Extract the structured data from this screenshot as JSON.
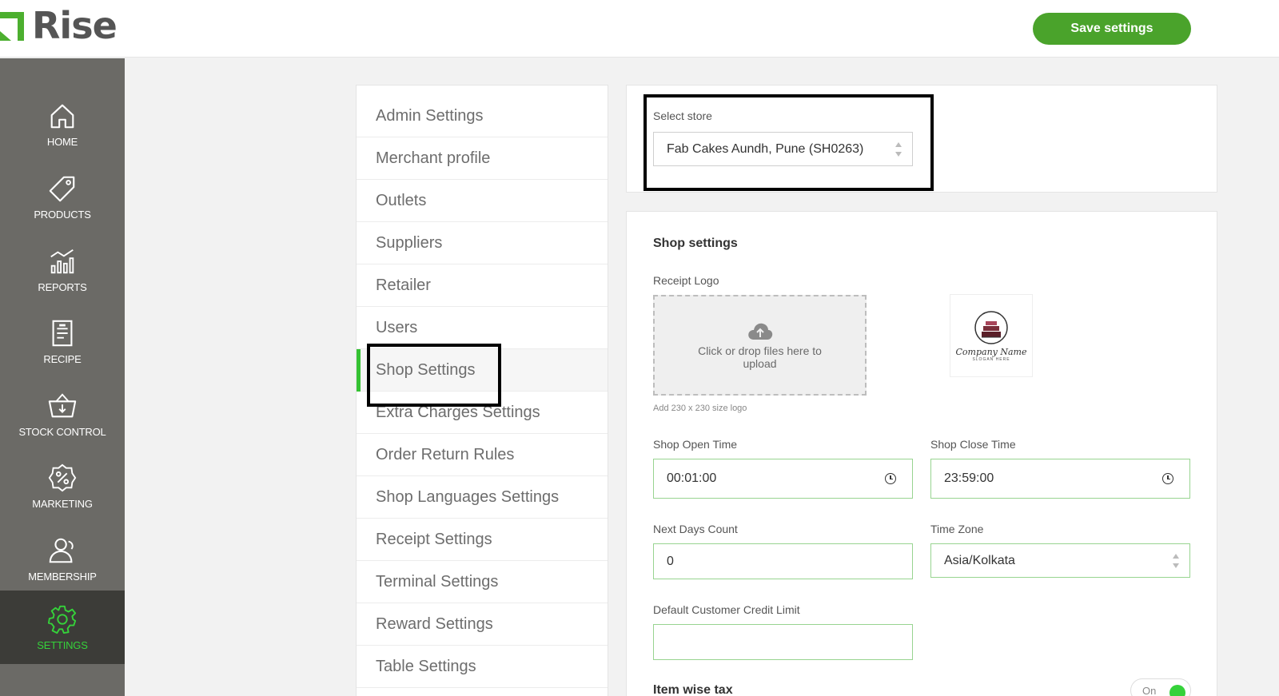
{
  "header": {
    "logo_text": "Rise",
    "save_label": "Save settings"
  },
  "sidebar": {
    "items": [
      {
        "label": "HOME",
        "icon": "home-icon"
      },
      {
        "label": "PRODUCTS",
        "icon": "tag-icon"
      },
      {
        "label": "REPORTS",
        "icon": "reports-icon"
      },
      {
        "label": "RECIPE",
        "icon": "recipe-icon"
      },
      {
        "label": "STOCK CONTROL",
        "icon": "basket-icon"
      },
      {
        "label": "MARKETING",
        "icon": "percent-badge-icon"
      },
      {
        "label": "MEMBERSHIP",
        "icon": "members-icon"
      },
      {
        "label": "SETTINGS",
        "icon": "gear-icon",
        "active": true
      }
    ]
  },
  "settings_menu": {
    "items": [
      "Admin Settings",
      "Merchant profile",
      "Outlets",
      "Suppliers",
      "Retailer",
      "Users",
      "Shop Settings",
      "Extra Charges Settings",
      "Order Return Rules",
      "Shop Languages Settings",
      "Receipt Settings",
      "Terminal Settings",
      "Reward Settings",
      "Table Settings"
    ],
    "active": "Shop Settings"
  },
  "store": {
    "label": "Select store",
    "value": "Fab Cakes Aundh, Pune (SH0263)"
  },
  "shop": {
    "title": "Shop settings",
    "receipt_logo_label": "Receipt Logo",
    "upload_text": "Click or drop files here to upload",
    "logo_hint": "Add 230 x 230 size logo",
    "logo_preview": {
      "company_name": "Company Name",
      "slogan": "SLOGAN HERE"
    },
    "open_time_label": "Shop Open Time",
    "open_time": "00:01:00",
    "close_time_label": "Shop Close Time",
    "close_time": "23:59:00",
    "next_days_label": "Next Days Count",
    "next_days": "0",
    "timezone_label": "Time Zone",
    "timezone": "Asia/Kolkata",
    "credit_limit_label": "Default Customer Credit Limit",
    "credit_limit": "",
    "item_wise_tax_label": "Item wise tax",
    "item_wise_tax_toggle": "On"
  },
  "colors": {
    "brand_green": "#4aa32b",
    "active_green": "#35d23a",
    "sidebar_bg": "#6b6a66"
  }
}
